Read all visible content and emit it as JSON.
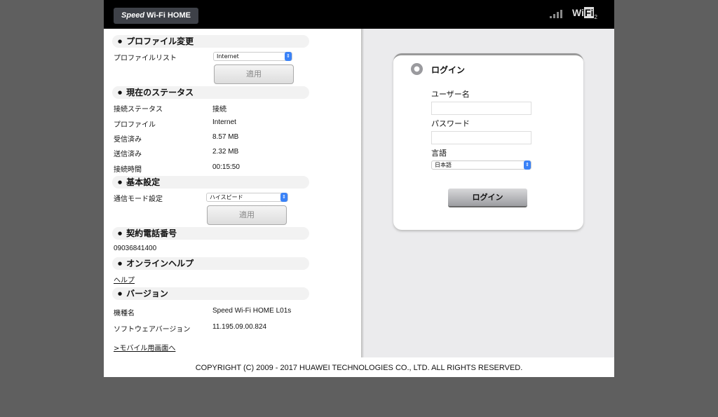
{
  "header": {
    "logo_italic": "Speed",
    "logo_rest": "Wi-Fi HOME",
    "signal_bars": 4,
    "wifi_label_a": "Wi",
    "wifi_label_b": "Fi",
    "wifi_sub": "2"
  },
  "sections": {
    "profile": {
      "title": "プロファイル変更",
      "list_label": "プロファイルリスト",
      "list_value": "Internet",
      "apply": "適用"
    },
    "status": {
      "title": "現在のステータス",
      "rows": [
        {
          "label": "接続ステータス",
          "value": "接続"
        },
        {
          "label": "プロファイル",
          "value": "Internet"
        },
        {
          "label": "受信済み",
          "value": "8.57 MB"
        },
        {
          "label": "送信済み",
          "value": "2.32 MB"
        },
        {
          "label": "接続時間",
          "value": "00:15:50"
        }
      ]
    },
    "basic": {
      "title": "基本設定",
      "mode_label": "通信モード設定",
      "mode_value": "ハイスピード",
      "apply": "適用"
    },
    "phone": {
      "title": "契約電話番号",
      "number": "09036841400"
    },
    "help": {
      "title": "オンラインヘルプ",
      "link": "ヘルプ"
    },
    "version": {
      "title": "バージョン",
      "rows": [
        {
          "label": "機種名",
          "value": "Speed Wi-Fi HOME L01s"
        },
        {
          "label": "ソフトウェアバージョン",
          "value": "11.195.09.00.824"
        }
      ]
    },
    "mobile_link": ">モバイル用画面へ"
  },
  "login": {
    "title": "ログイン",
    "username_label": "ユーザー名",
    "username_value": "",
    "password_label": "パスワード",
    "password_value": "",
    "language_label": "言語",
    "language_value": "日本語",
    "button": "ログイン"
  },
  "footer": "COPYRIGHT (C) 2009 - 2017 HUAWEI TECHNOLOGIES CO., LTD. ALL RIGHTS RESERVED."
}
